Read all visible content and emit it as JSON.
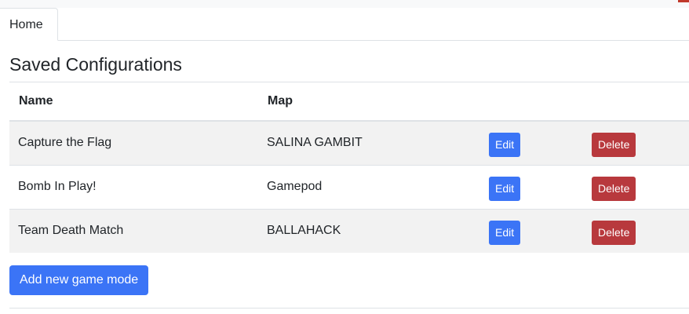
{
  "tabs": [
    {
      "label": "Home",
      "active": true
    }
  ],
  "page": {
    "title": "Saved Configurations"
  },
  "table": {
    "headers": [
      "Name",
      "Map"
    ],
    "rows": [
      {
        "name": "Capture the Flag",
        "map": "SALINA GAMBIT",
        "edit_label": "Edit",
        "delete_label": "Delete"
      },
      {
        "name": "Bomb In Play!",
        "map": "Gamepod",
        "edit_label": "Edit",
        "delete_label": "Delete"
      },
      {
        "name": "Team Death Match",
        "map": "BALLAHACK",
        "edit_label": "Edit",
        "delete_label": "Delete"
      }
    ]
  },
  "actions": {
    "add_label": "Add new game mode"
  },
  "colors": {
    "primary": "#3b74f6",
    "danger": "#b8393d",
    "stripe": "#f2f2f2",
    "border": "#dee2e6"
  }
}
